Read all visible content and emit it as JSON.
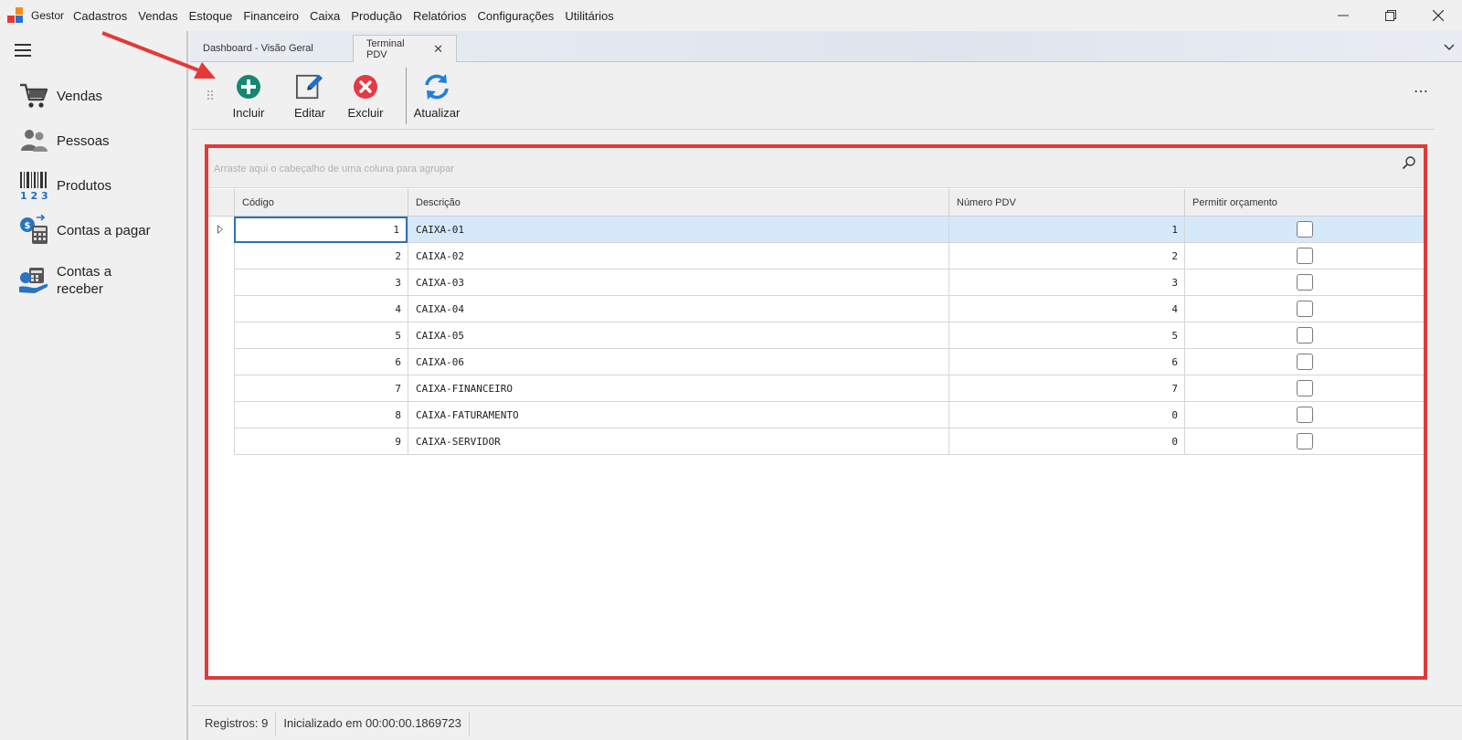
{
  "app": {
    "title": "Gestor",
    "menu": [
      "Cadastros",
      "Vendas",
      "Estoque",
      "Financeiro",
      "Caixa",
      "Produção",
      "Relatórios",
      "Configurações",
      "Utilitários"
    ]
  },
  "sidebar": {
    "items": [
      {
        "label": "Vendas",
        "icon": "cart-icon"
      },
      {
        "label": "Pessoas",
        "icon": "people-icon"
      },
      {
        "label": "Produtos",
        "icon": "barcode-icon"
      },
      {
        "label": "Contas a pagar",
        "icon": "calculator-coin-icon"
      },
      {
        "label": "Contas a receber",
        "icon": "hand-money-icon"
      }
    ]
  },
  "tabs": [
    {
      "label": "Dashboard - Visão Geral",
      "active": false
    },
    {
      "label": "Terminal PDV",
      "active": true
    }
  ],
  "toolbar": {
    "include_label": "Incluir",
    "edit_label": "Editar",
    "delete_label": "Excluir",
    "refresh_label": "Atualizar",
    "colors": {
      "include": "#16876f",
      "delete": "#e53945",
      "refresh": "#1f7fd9",
      "edit": "#1f6fc6"
    }
  },
  "grid": {
    "group_hint": "Arraste aqui o cabeçalho de uma coluna para agrupar",
    "columns": [
      "Código",
      "Descrição",
      "Número PDV",
      "Permitir orçamento"
    ],
    "rows": [
      {
        "codigo": "1",
        "descricao": "CAIXA-01",
        "numero_pdv": "1",
        "permitir_orcamento": false
      },
      {
        "codigo": "2",
        "descricao": "CAIXA-02",
        "numero_pdv": "2",
        "permitir_orcamento": false
      },
      {
        "codigo": "3",
        "descricao": "CAIXA-03",
        "numero_pdv": "3",
        "permitir_orcamento": false
      },
      {
        "codigo": "4",
        "descricao": "CAIXA-04",
        "numero_pdv": "4",
        "permitir_orcamento": false
      },
      {
        "codigo": "5",
        "descricao": "CAIXA-05",
        "numero_pdv": "5",
        "permitir_orcamento": false
      },
      {
        "codigo": "6",
        "descricao": "CAIXA-06",
        "numero_pdv": "6",
        "permitir_orcamento": false
      },
      {
        "codigo": "7",
        "descricao": "CAIXA-FINANCEIRO",
        "numero_pdv": "7",
        "permitir_orcamento": false
      },
      {
        "codigo": "8",
        "descricao": "CAIXA-FATURAMENTO",
        "numero_pdv": "0",
        "permitir_orcamento": false
      },
      {
        "codigo": "9",
        "descricao": "CAIXA-SERVIDOR",
        "numero_pdv": "0",
        "permitir_orcamento": false
      }
    ],
    "selected_row": 0,
    "highlight_color": "#e03a3a"
  },
  "status": {
    "records": "Registros: 9",
    "init": "Inicializado em 00:00:00.1869723"
  }
}
